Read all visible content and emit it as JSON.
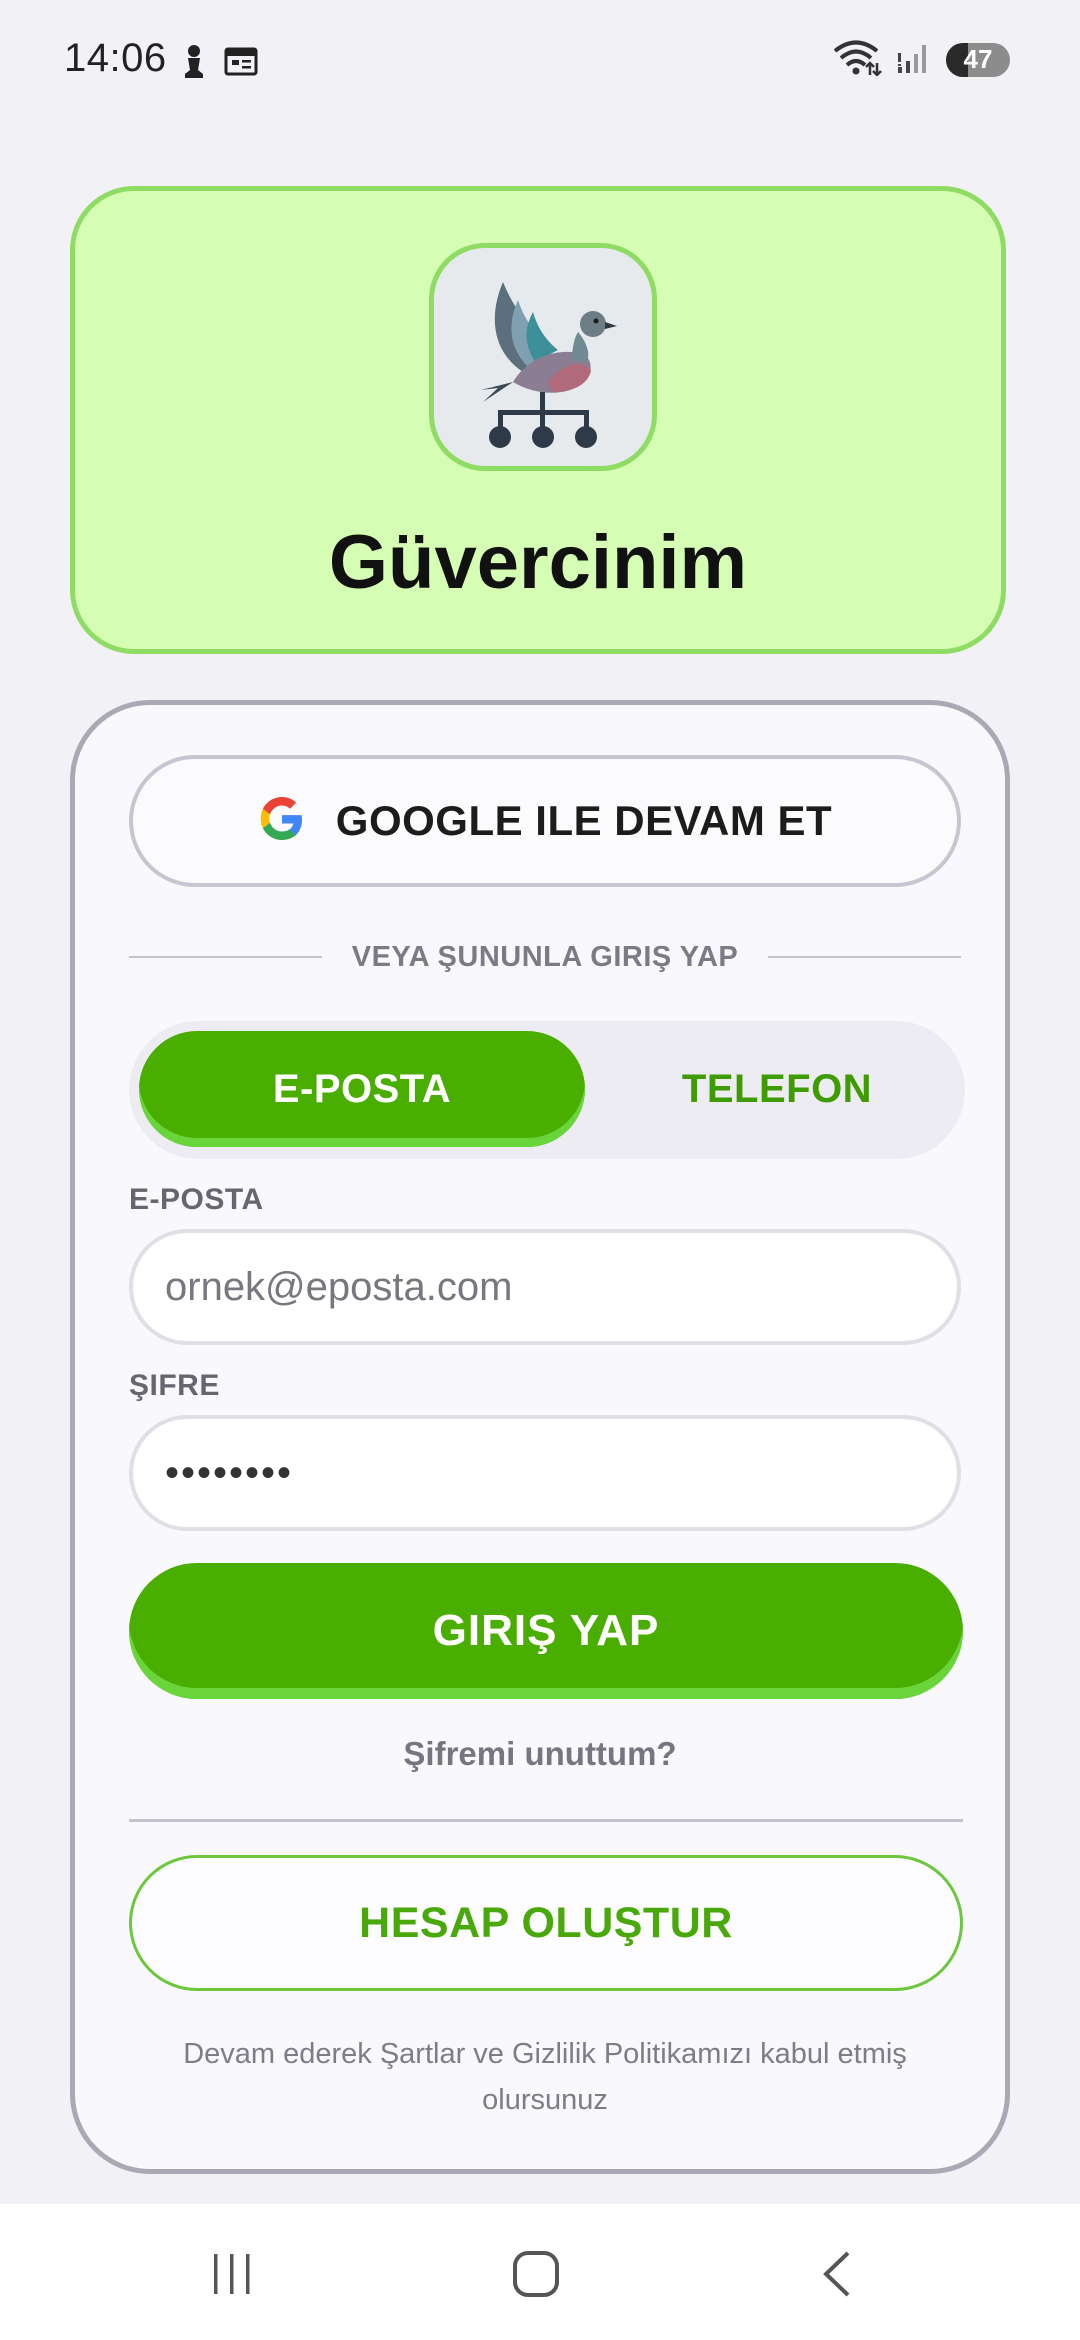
{
  "status_bar": {
    "time": "14:06",
    "battery": "47",
    "icons": [
      "person-icon",
      "calendar-icon",
      "wifi-icon",
      "signal-icon",
      "battery-icon"
    ]
  },
  "header": {
    "app_name": "Güvercinim",
    "logo_icon": "pigeon-network-logo"
  },
  "login": {
    "google_button": "GOOGLE ILE DEVAM ET",
    "divider_text": "VEYA ŞUNUNLA GIRIŞ YAP",
    "tabs": {
      "email": "E-POSTA",
      "phone": "TELEFON",
      "selected": "email"
    },
    "email_label": "E-POSTA",
    "email_placeholder": "ornek@eposta.com",
    "password_label": "ŞIFRE",
    "password_value": "••••••••",
    "login_button": "GIRIŞ YAP",
    "forgot_password": "Şifremi unuttum?",
    "create_account": "HESAP OLUŞTUR",
    "terms": "Devam ederek Şartlar ve Gizlilik Politikamızı kabul etmiş olursunuz"
  },
  "colors": {
    "primary": "#4aae00",
    "primary_light": "#6ad43b",
    "header_bg": "#d5fdb3",
    "header_border": "#8edc64"
  },
  "nav": {
    "icons": [
      "recent-apps-icon",
      "home-icon",
      "back-icon"
    ]
  }
}
